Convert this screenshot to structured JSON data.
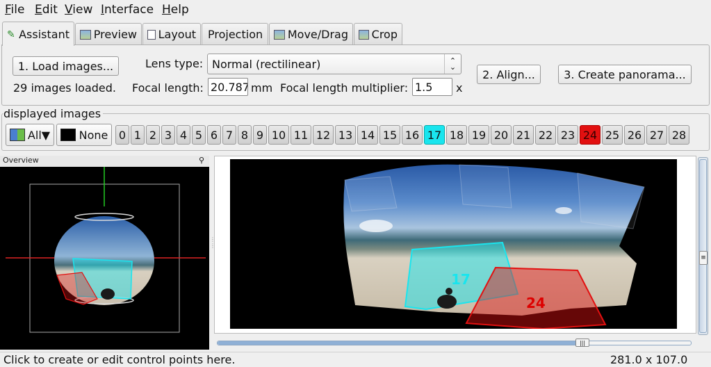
{
  "menu": {
    "items": [
      {
        "label_underlined": "F",
        "label_rest": "ile"
      },
      {
        "label_underlined": "E",
        "label_rest": "dit"
      },
      {
        "label_underlined": "V",
        "label_rest": "iew"
      },
      {
        "label_underlined": "I",
        "label_rest": "nterface"
      },
      {
        "label_underlined": "H",
        "label_rest": "elp"
      }
    ]
  },
  "tabs": [
    {
      "label": "Assistant",
      "icon": "wand-icon",
      "active": true
    },
    {
      "label": "Preview",
      "icon": "image-icon"
    },
    {
      "label": "Layout",
      "icon": "layout-icon"
    },
    {
      "label": "Projection",
      "icon": ""
    },
    {
      "label": "Move/Drag",
      "icon": "image-icon"
    },
    {
      "label": "Crop",
      "icon": "image-icon"
    }
  ],
  "assistant": {
    "load_button": "1. Load images...",
    "images_loaded": "29 images loaded.",
    "lens_type_label": "Lens type:",
    "lens_type_value": "Normal (rectilinear)",
    "focal_length_label": "Focal length:",
    "focal_length_value": "20.787",
    "focal_length_unit": "mm",
    "multiplier_label": "Focal length multiplier:",
    "multiplier_value": "1.5",
    "multiplier_unit": "x",
    "align_button": "2. Align...",
    "create_button": "3. Create panorama..."
  },
  "displayed_images": {
    "title": "displayed images",
    "all_button": "All▼",
    "none_button": "None",
    "numbers": [
      "0",
      "1",
      "2",
      "3",
      "4",
      "5",
      "6",
      "7",
      "8",
      "9",
      "10",
      "11",
      "12",
      "13",
      "14",
      "15",
      "16",
      "17",
      "18",
      "19",
      "20",
      "21",
      "22",
      "23",
      "24",
      "25",
      "26",
      "27",
      "28"
    ],
    "selected_cyan": "17",
    "selected_red": "24"
  },
  "overview": {
    "title": "Overview"
  },
  "preview": {
    "label_cyan": "17",
    "label_red": "24",
    "slider_fraction": 0.77
  },
  "status": {
    "text": "Click to create or edit control points here.",
    "size": "281.0 x 107.0"
  },
  "colors": {
    "cyan": "#19e5ee",
    "red": "#e21010"
  }
}
